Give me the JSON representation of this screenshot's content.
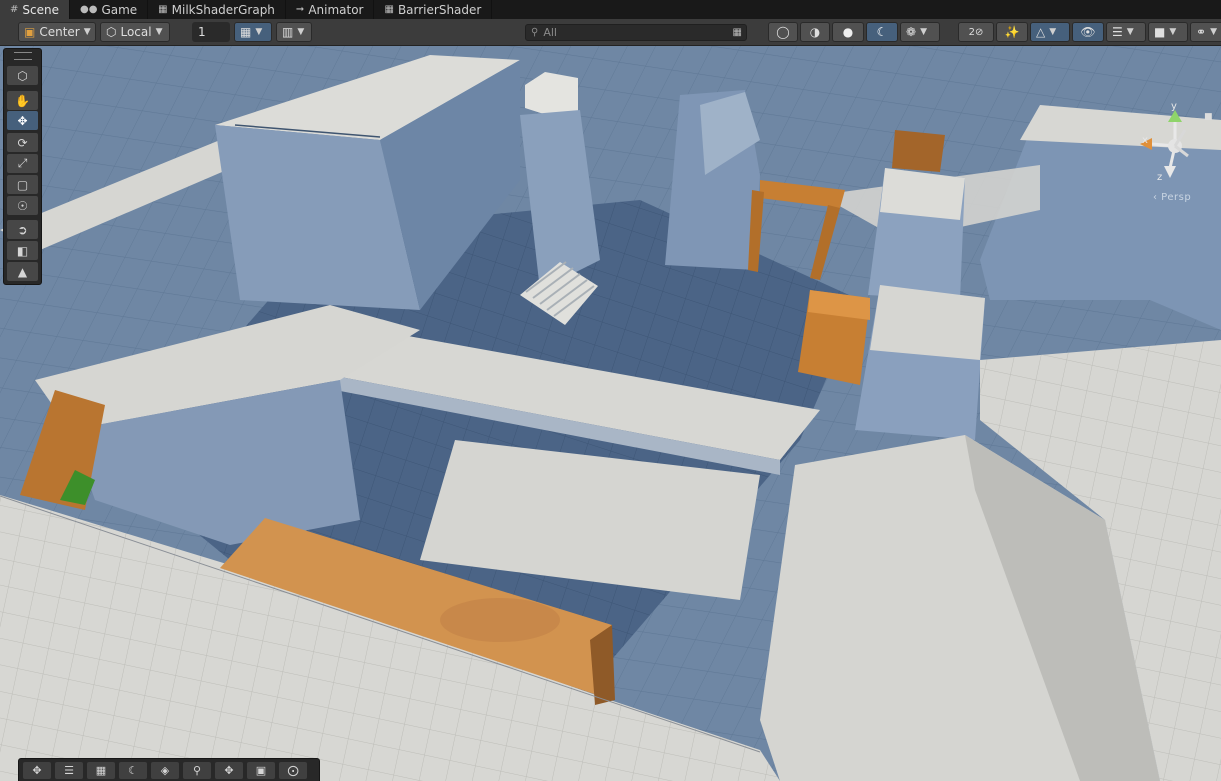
{
  "tabs": [
    {
      "label": "Scene",
      "icon": "grid-icon",
      "active": true
    },
    {
      "label": "Game",
      "icon": "gamepad-icon",
      "active": false
    },
    {
      "label": "MilkShaderGraph",
      "icon": "shadergraph-icon",
      "active": false
    },
    {
      "label": "Animator",
      "icon": "animator-icon",
      "active": false
    },
    {
      "label": "BarrierShader",
      "icon": "shadergraph-icon",
      "active": false
    }
  ],
  "toolbar": {
    "pivot_label": "Center",
    "space_label": "Local",
    "snap_value": "1",
    "search_placeholder": "All"
  },
  "gizmo": {
    "x": "x",
    "y": "y",
    "z": "z",
    "persp": "‹ Persp"
  },
  "colors": {
    "accent": "#46607c",
    "sky": "#6f87a4",
    "floor": "#d3d3cf",
    "wall": "#7b93b2",
    "crate": "#c77f33"
  }
}
